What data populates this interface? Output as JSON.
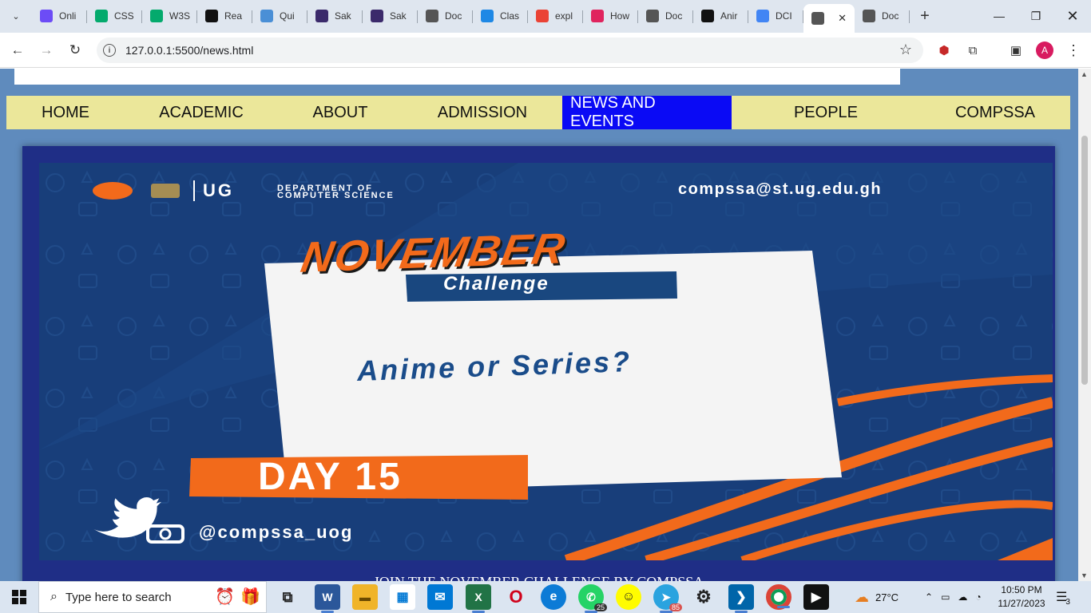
{
  "browser": {
    "tabs": [
      {
        "label": "Onli",
        "icon": "pencil-p-icon",
        "color": "#6c4cf6"
      },
      {
        "label": "CSS",
        "icon": "w3schools-icon",
        "color": "#04aa6d"
      },
      {
        "label": "W3S",
        "icon": "w3schools-icon",
        "color": "#04aa6d"
      },
      {
        "label": "Rea",
        "icon": "dev-logo-icon",
        "color": "#111111"
      },
      {
        "label": "Qui",
        "icon": "react-icon",
        "color": "#4a8fd6"
      },
      {
        "label": "Sak",
        "icon": "university-crest-icon",
        "color": "#3b2a6b"
      },
      {
        "label": "Sak",
        "icon": "university-crest-icon",
        "color": "#3b2a6b"
      },
      {
        "label": "Doc",
        "icon": "globe-icon",
        "color": "#555555"
      },
      {
        "label": "Clas",
        "icon": "classroom-icon",
        "color": "#1e88e5"
      },
      {
        "label": "expl",
        "icon": "google-g-icon",
        "color": "#ea4335"
      },
      {
        "label": "How",
        "icon": "map-pin-icon",
        "color": "#e0245e"
      },
      {
        "label": "Doc",
        "icon": "globe-icon",
        "color": "#555555"
      },
      {
        "label": "Anir",
        "icon": "github-icon",
        "color": "#111111"
      },
      {
        "label": "DCI",
        "icon": "docs-icon",
        "color": "#4285f4"
      },
      {
        "label": "",
        "icon": "globe-icon",
        "color": "#555555",
        "active": true
      },
      {
        "label": "Doc",
        "icon": "globe-icon",
        "color": "#555555"
      }
    ],
    "url": "127.0.0.1:5500/news.html",
    "profile_initial": "A"
  },
  "site": {
    "nav": [
      {
        "label": "HOME"
      },
      {
        "label": "ACADEMIC"
      },
      {
        "label": "ABOUT"
      },
      {
        "label": "ADMISSION"
      },
      {
        "label": "NEWS AND EVENTS",
        "active": true
      },
      {
        "label": "PEOPLE"
      },
      {
        "label": "COMPSSA"
      }
    ],
    "poster": {
      "org_short": "UG",
      "dept_line1": "DEPARTMENT OF",
      "dept_line2": "COMPUTER SCIENCE",
      "email": "compssa@st.ug.edu.gh",
      "headline": "NOVEMBER",
      "subheadline": "Challenge",
      "question": "Anime or Series?",
      "day": "DAY 15",
      "handle": "@compssa_uog"
    },
    "caption": "JOIN THE NOVEMBER CHALLENGE BY COMPSSA",
    "colors": {
      "nav_bg": "#ebe79a",
      "nav_active": "#0a0af5",
      "page_bg": "#5f8bbd",
      "poster_bg": "#183e7a",
      "accent_orange": "#f26a1b"
    }
  },
  "taskbar": {
    "search_placeholder": "Type here to search",
    "whatsapp_badge": "25",
    "telegram_badge": "85",
    "weather": "27°C",
    "time": "10:50 PM",
    "date": "11/27/2023",
    "notifications": "3"
  }
}
